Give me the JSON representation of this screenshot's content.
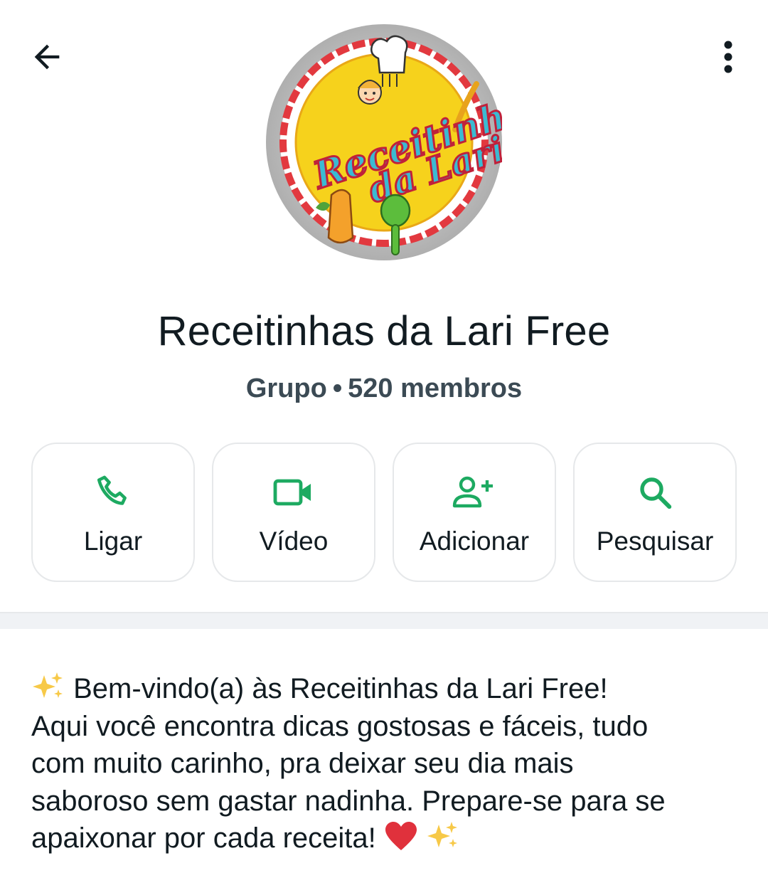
{
  "header": {
    "back_icon": "arrow-left-icon",
    "menu_icon": "more-vertical-icon"
  },
  "avatar": {
    "logo_line1": "Receitinhas",
    "logo_line2": "da Lari"
  },
  "group": {
    "name": "Receitinhas da Lari Free",
    "type": "Grupo",
    "separator": "•",
    "members": "520 membros"
  },
  "actions": [
    {
      "label": "Ligar",
      "icon": "phone-icon"
    },
    {
      "label": "Vídeo",
      "icon": "video-icon"
    },
    {
      "label": "Adicionar",
      "icon": "add-person-icon"
    },
    {
      "label": "Pesquisar",
      "icon": "search-icon"
    }
  ],
  "description": {
    "line1": "Bem-vindo(a) às Receitinhas da Lari Free!",
    "line2": "Aqui você encontra dicas gostosas e fáceis, tudo",
    "line3": "com muito carinho, pra deixar seu dia mais",
    "line4": "saboroso sem gastar nadinha. Prepare-se para se",
    "line5": "apaixonar por cada receita!"
  },
  "colors": {
    "accent": "#1daa61",
    "text": "#111b21",
    "subtext": "#3b4a54"
  }
}
